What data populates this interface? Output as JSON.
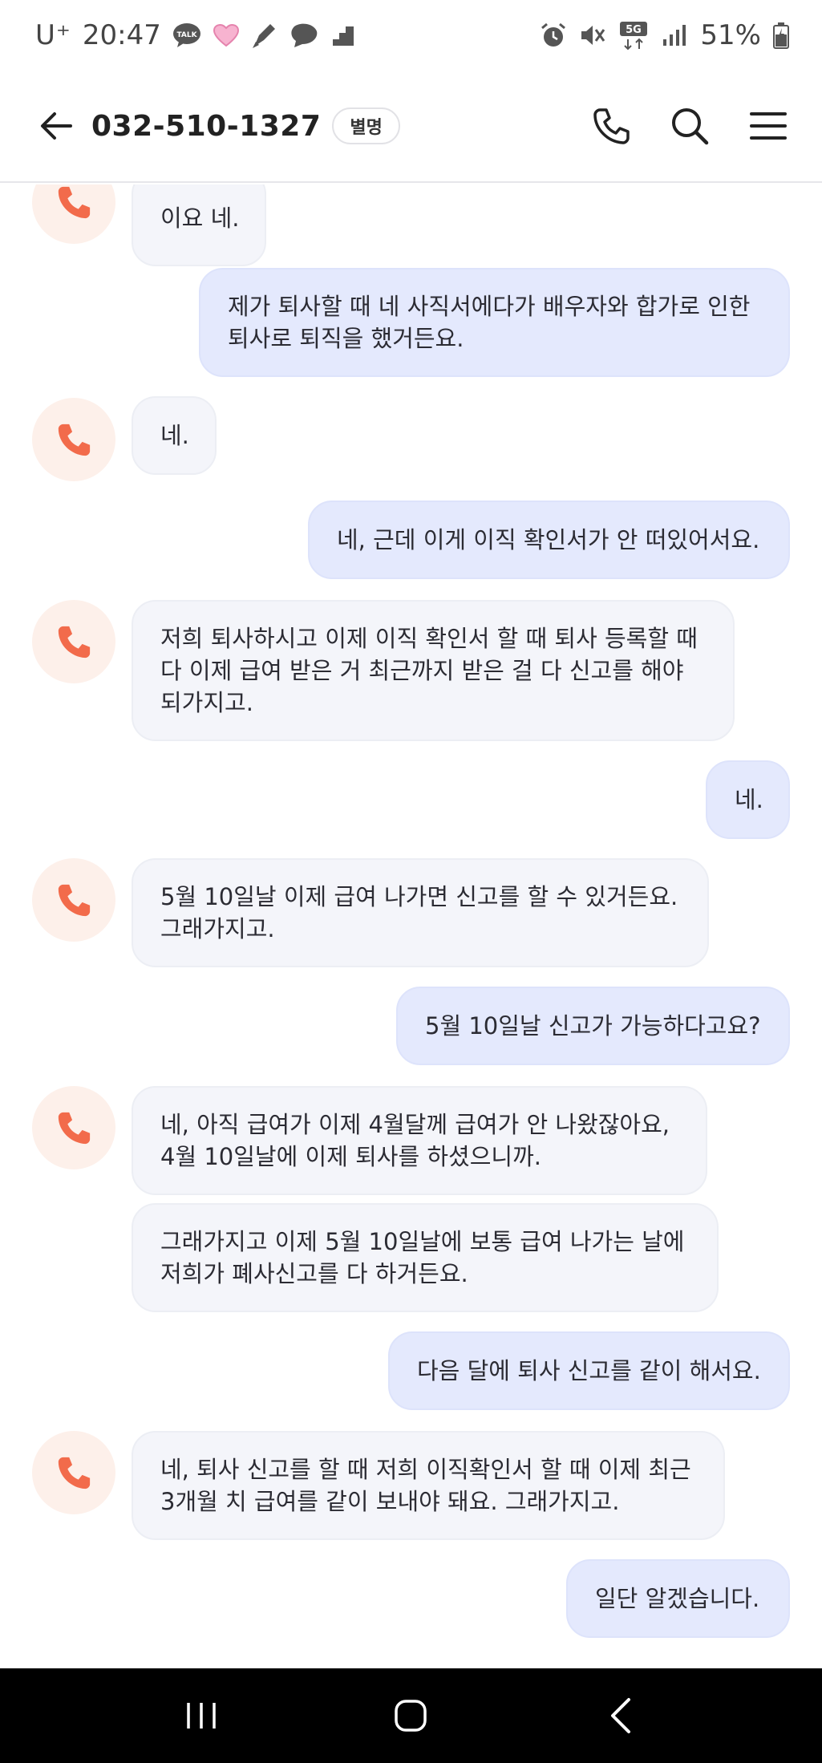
{
  "status_bar": {
    "carrier": "U⁺",
    "time": "20:47",
    "network": "5G",
    "battery": "51%",
    "notification_icons": [
      "talk-icon",
      "heart-icon",
      "pen-icon",
      "chat-leaf-icon",
      "stairs-icon"
    ],
    "system_icons": [
      "alarm-icon",
      "mute-icon",
      "5g-icon",
      "signal-icon",
      "battery-icon"
    ]
  },
  "header": {
    "phone_number": "032-510-1327",
    "alias_label": "별명",
    "actions": [
      "phone-icon",
      "search-icon",
      "menu-icon"
    ]
  },
  "messages": [
    {
      "side": "in",
      "lines": [
        "이요 네."
      ]
    },
    {
      "side": "out",
      "lines": [
        "제가 퇴사할 때 네 사직서에다가 배우자와 합가로 인한",
        "퇴사로 퇴직을 했거든요."
      ]
    },
    {
      "side": "in",
      "lines": [
        "네."
      ]
    },
    {
      "side": "out",
      "lines": [
        "네, 근데 이게 이직 확인서가 안 떠있어서요."
      ]
    },
    {
      "side": "in",
      "lines": [
        "저희 퇴사하시고 이제 이직 확인서 할 때 퇴사 등록할 때",
        "다 이제 급여 받은 거 최근까지 받은 걸 다 신고를 해야",
        "되가지고."
      ]
    },
    {
      "side": "out",
      "lines": [
        "네."
      ]
    },
    {
      "side": "in",
      "lines": [
        "5월 10일날 이제 급여 나가면 신고를 할 수 있거든요.",
        "그래가지고."
      ]
    },
    {
      "side": "out",
      "lines": [
        "5월 10일날 신고가 가능하다고요?"
      ]
    },
    {
      "side": "in",
      "lines": [
        "네, 아직 급여가 이제 4월달께 급여가 안 나왔잖아요,",
        "4월 10일날에 이제 퇴사를 하셨으니까."
      ]
    },
    {
      "side": "in",
      "lines": [
        "그래가지고 이제 5월 10일날에 보통 급여 나가는 날에",
        "저희가 폐사신고를 다 하거든요."
      ]
    },
    {
      "side": "out",
      "lines": [
        "다음 달에 퇴사 신고를 같이 해서요."
      ]
    },
    {
      "side": "in",
      "lines": [
        "네, 퇴사 신고를 할 때 저희 이직확인서 할 때 이제 최근",
        "3개월 치 급여를 같이 보내야 돼요. 그래가지고."
      ]
    },
    {
      "side": "out",
      "lines": [
        "일단 알겠습니다."
      ]
    }
  ],
  "colors": {
    "incoming_bubble": "#f4f5fa",
    "outgoing_bubble": "#e4e9fd",
    "avatar_bg": "#fdf0ea",
    "call_icon": "#f26b4b",
    "nav_bar": "#000000"
  },
  "nav_bar": {
    "buttons": [
      "recent-apps-icon",
      "home-icon",
      "back-icon"
    ]
  }
}
